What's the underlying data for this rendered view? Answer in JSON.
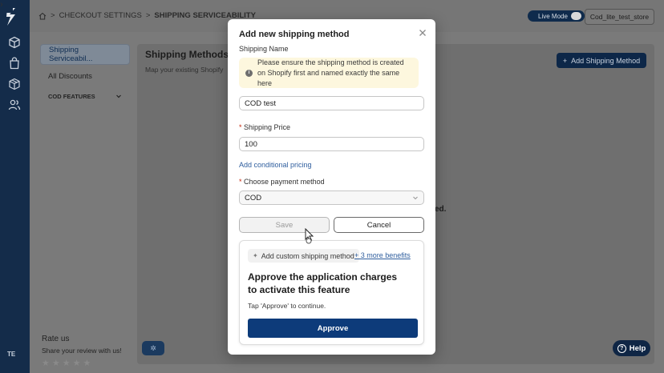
{
  "rail": {
    "user_initials": "TE"
  },
  "header": {
    "breadcrumb": [
      "CHECKOUT SETTINGS",
      "SHIPPING SERVICEABILITY"
    ],
    "live_mode_label": "Live Mode",
    "store_name": "Cod_lite_test_store"
  },
  "sidebar": {
    "items": [
      {
        "label": "Shipping Serviceabil...",
        "active": true
      },
      {
        "label": "All Discounts",
        "active": false
      }
    ],
    "group_label": "COD FEATURES"
  },
  "main": {
    "title": "Shipping Methods",
    "subtitle": "Map your existing Shopify",
    "add_button_label": "Add Shipping Method",
    "empty_text_fragment": "ed."
  },
  "rate_us": {
    "title": "Rate us",
    "subtitle": "Share your review with us!",
    "stars": "★★★★★"
  },
  "help_label": "Help",
  "modal": {
    "title": "Add new shipping method",
    "shipping_name_label": "Shipping Name",
    "notice_text": "Please ensure the shipping method is created on Shopify first and named exactly the same here",
    "shipping_name_value": "COD test",
    "shipping_price_label": "Shipping Price",
    "shipping_price_value": "100",
    "conditional_pricing_link": "Add conditional pricing",
    "payment_method_label": "Choose payment method",
    "payment_method_value": "COD",
    "save_label": "Save",
    "cancel_label": "Cancel",
    "upsell": {
      "chip_label": "Add custom shipping method",
      "benefits_link": "+ 3 more benefits",
      "heading": "Approve the application charges to activate this feature",
      "tap_text": "Tap 'Approve' to continue.",
      "approve_label": "Approve"
    }
  }
}
